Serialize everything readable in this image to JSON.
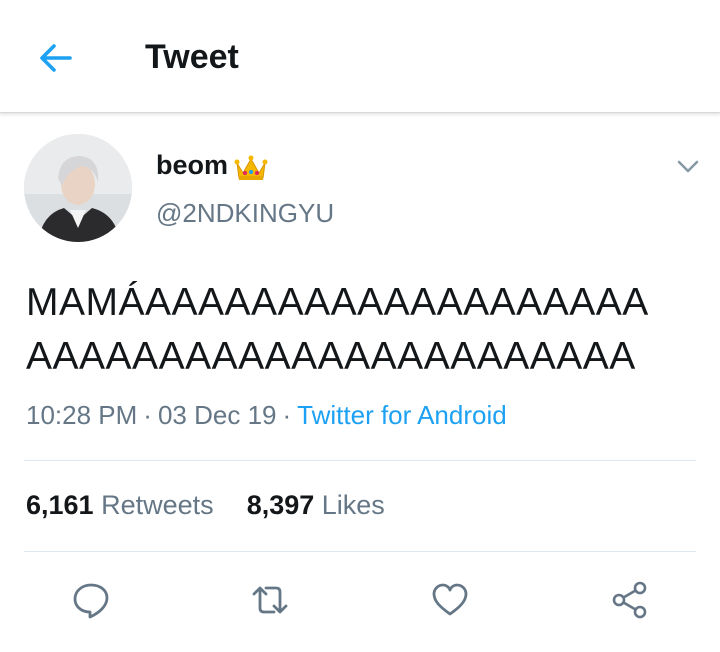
{
  "header": {
    "title": "Tweet",
    "back_icon": "arrow-left-icon",
    "accent": "#1da1f2"
  },
  "author": {
    "display_name": "beom",
    "emoji_icon": "crown-icon",
    "handle": "@2NDKINGYU",
    "caret_icon": "chevron-down-icon"
  },
  "tweet": {
    "lines": [
      "MAMÁAAAAAAAAAAAAAAAAAAA",
      "AAAAAAAAAAAAAAAAAAAAAAA"
    ]
  },
  "meta": {
    "time": "10:28 PM",
    "separator": "·",
    "date": "03 Dec 19",
    "source": "Twitter for Android"
  },
  "stats": {
    "retweets_count": "6,161",
    "retweets_label": "Retweets",
    "likes_count": "8,397",
    "likes_label": "Likes"
  },
  "actions": [
    "reply-icon",
    "retweet-icon",
    "heart-icon",
    "share-icon"
  ],
  "colors": {
    "primary_text": "#14171a",
    "secondary_text": "#657786",
    "link": "#1da1f2",
    "divider": "#e1e8ed"
  }
}
